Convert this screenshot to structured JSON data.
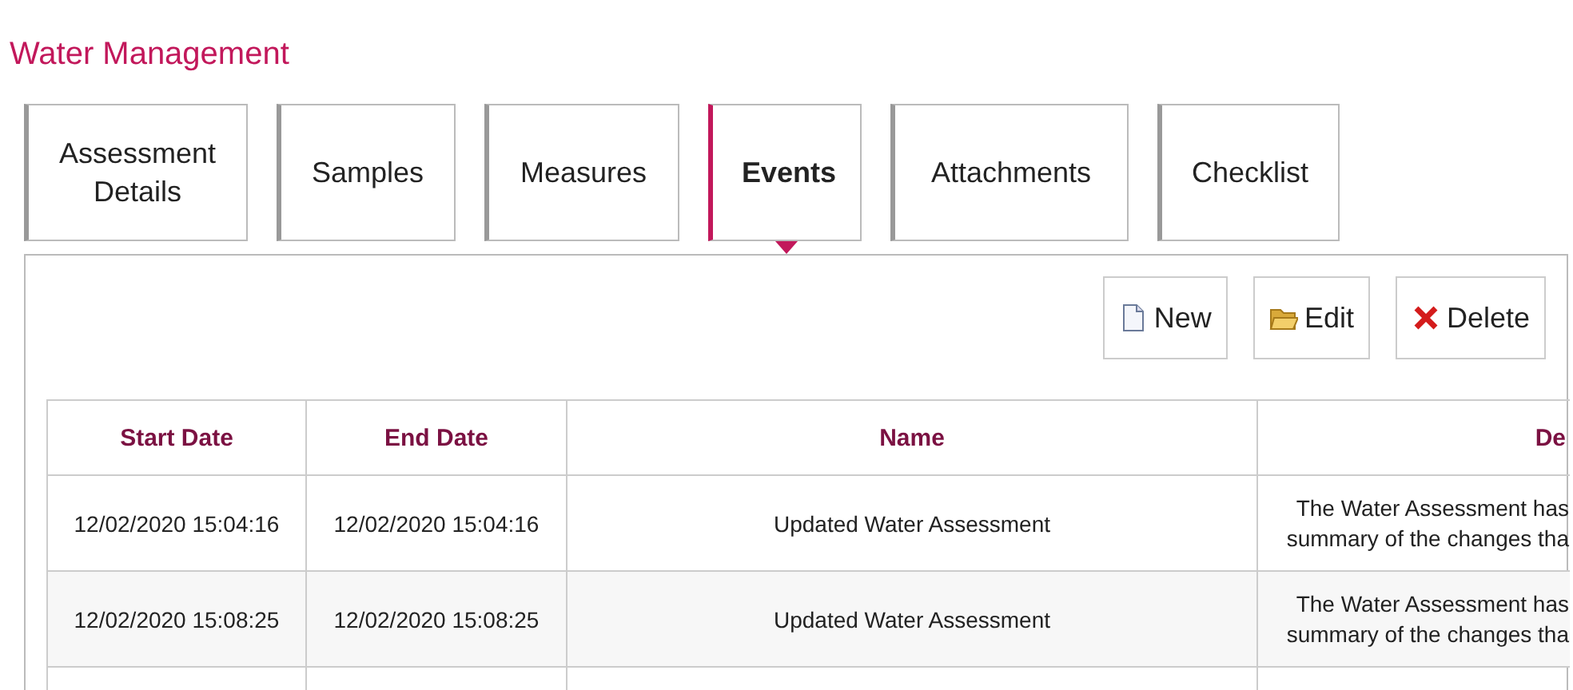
{
  "title": "Water Management",
  "tabs": [
    {
      "label": "Assessment Details",
      "selected": false
    },
    {
      "label": "Samples",
      "selected": false
    },
    {
      "label": "Measures",
      "selected": false
    },
    {
      "label": "Events",
      "selected": true
    },
    {
      "label": "Attachments",
      "selected": false
    },
    {
      "label": "Checklist",
      "selected": false
    }
  ],
  "toolbar": [
    {
      "kind": "new",
      "label": "New"
    },
    {
      "kind": "edit",
      "label": "Edit"
    },
    {
      "kind": "delete",
      "label": "Delete"
    }
  ],
  "table": {
    "columns": [
      "Start Date",
      "End Date",
      "Name",
      "De"
    ],
    "rows": [
      {
        "cells": [
          "12/02/2020 15:04:16",
          "12/02/2020 15:04:16",
          "Updated Water Assessment",
          [
            "The Water Assessment has",
            "summary of the changes tha"
          ]
        ]
      },
      {
        "cells": [
          "12/02/2020 15:08:25",
          "12/02/2020 15:08:25",
          "Updated Water Assessment",
          [
            "The Water Assessment has",
            "summary of the changes tha"
          ]
        ]
      }
    ]
  }
}
